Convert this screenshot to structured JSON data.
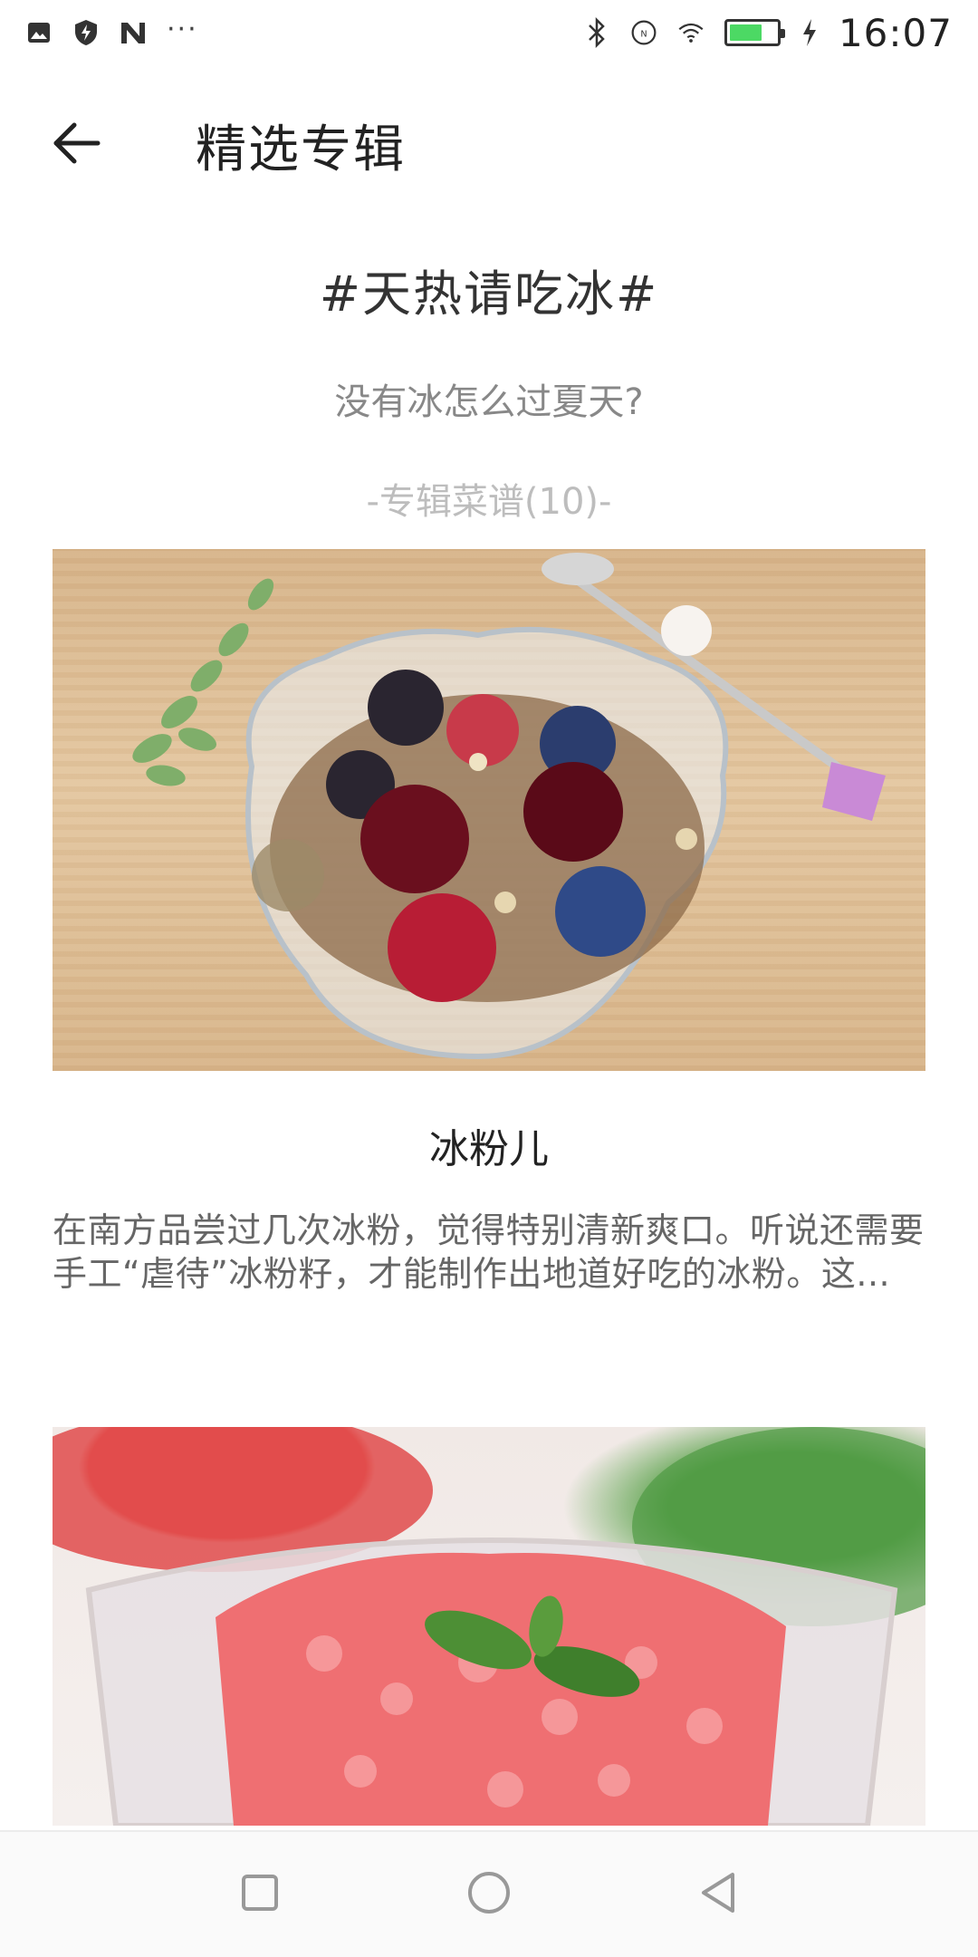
{
  "status_bar": {
    "time": "16:07",
    "left_icons": [
      "image-icon",
      "shield-bolt-icon",
      "n-logo-icon"
    ],
    "overflow": "···",
    "right_icons": [
      "bluetooth-icon",
      "nfc-icon",
      "wifi-icon",
      "battery-icon",
      "charging-icon"
    ],
    "battery_level": 0.7,
    "battery_color": "#4cd964"
  },
  "app_bar": {
    "title": "精选专辑",
    "back_icon": "arrow-left-icon"
  },
  "album": {
    "title": "#天热请吃冰#",
    "subtitle": "没有冰怎么过夏天?",
    "count_label": "-专辑菜谱(10)-"
  },
  "recipes": [
    {
      "name": "冰粉儿",
      "description": "在南方品尝过几次冰粉，觉得特别清新爽口。听说还需要手工“虐待”冰粉籽，才能制作出地道好吃的冰粉。这..."
    },
    {
      "name": "",
      "description": ""
    }
  ],
  "nav_bar": {
    "icons": [
      "recent-apps-icon",
      "home-icon",
      "back-triangle-icon"
    ]
  }
}
